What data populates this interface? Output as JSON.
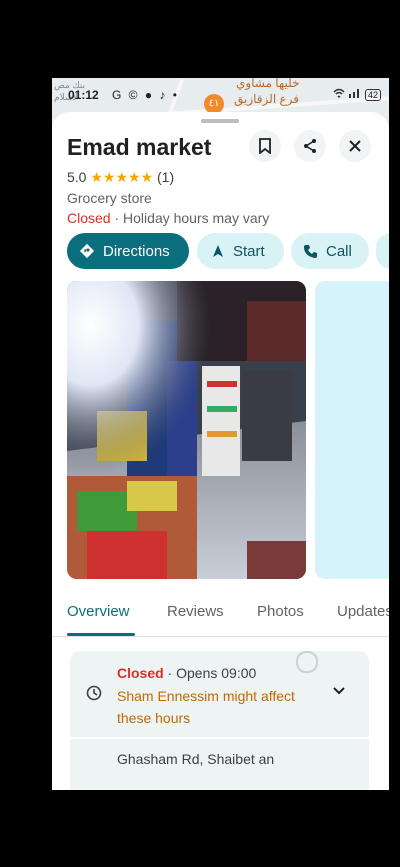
{
  "status_bar": {
    "time": "01:12",
    "notification_icons": "G © ● ♪ •",
    "battery": "42"
  },
  "map": {
    "label_main": "خليها مشاوي",
    "label_sub": "فرع الزقازيق",
    "label_left_1": "بنك مص",
    "label_left_2": "لاسلام",
    "pin_label": "٤١"
  },
  "place": {
    "name": "Emad market",
    "rating": "5.0",
    "stars": "★★★★★",
    "review_count": "(1)",
    "category": "Grocery store",
    "status": "Closed",
    "status_note": " · Holiday hours may vary"
  },
  "actions": {
    "directions": "Directions",
    "start": "Start",
    "call": "Call"
  },
  "tabs": [
    {
      "label": "Overview"
    },
    {
      "label": "Reviews"
    },
    {
      "label": "Photos"
    },
    {
      "label": "Updates"
    }
  ],
  "hours_card": {
    "status": "Closed",
    "opens": " · Opens 09:00",
    "notice": "Sham Ennessim might affect these hours",
    "address": "Ghasham Rd, Shaibet an"
  },
  "icons": {
    "save": "bookmark-icon",
    "share": "share-icon",
    "close": "close-icon",
    "directions": "directions-diamond-icon",
    "start": "navigation-arrow-icon",
    "call": "phone-icon",
    "clock": "clock-icon",
    "expand": "chevron-down-icon"
  },
  "colors": {
    "accent": "#0b6e7c",
    "accent_light": "#d8f2f6",
    "closed": "#d93025",
    "notice": "#c26a00",
    "stars": "#f7a600"
  }
}
